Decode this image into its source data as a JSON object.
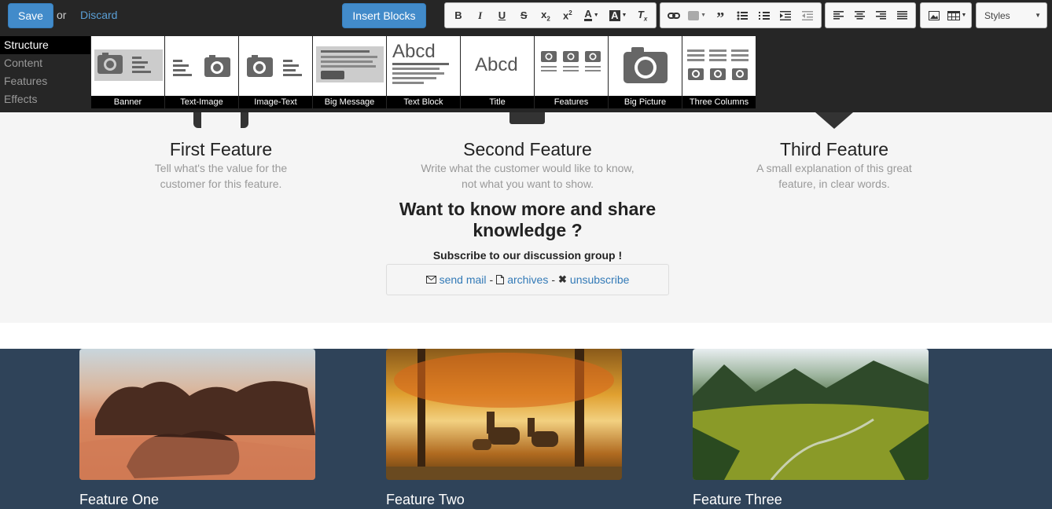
{
  "toolbar": {
    "save": "Save",
    "or": "or",
    "discard": "Discard",
    "insert_blocks": "Insert Blocks",
    "styles": "Styles",
    "format_icons": [
      "bold-icon",
      "italic-icon",
      "underline-icon",
      "strikethrough-icon",
      "subscript-icon",
      "superscript-icon",
      "text-color-icon",
      "background-color-icon",
      "remove-format-icon"
    ],
    "insert_icons": [
      "link-icon",
      "unlink-icon",
      "blockquote-icon",
      "bulleted-list-icon",
      "numbered-list-icon",
      "indent-icon",
      "outdent-icon"
    ],
    "align_icons": [
      "align-left-icon",
      "align-center-icon",
      "align-right-icon",
      "align-justify-icon"
    ],
    "media_icons": [
      "image-icon",
      "table-icon"
    ]
  },
  "snippet_panel": {
    "categories": [
      "Structure",
      "Content",
      "Features",
      "Effects"
    ],
    "active_category": "Structure",
    "blocks": [
      "Banner",
      "Text-Image",
      "Image-Text",
      "Big Message",
      "Text Block",
      "Title",
      "Features",
      "Big Picture",
      "Three Columns"
    ]
  },
  "features": [
    {
      "title": "First Feature",
      "desc": "Tell what's the value for the customer for this feature."
    },
    {
      "title": "Second Feature",
      "desc": "Write what the customer would like to know, not what you want to show."
    },
    {
      "title": "Third Feature",
      "desc": "A small explanation of this great feature, in clear words."
    }
  ],
  "cta": {
    "heading": "Want to know more and share knowledge ?",
    "subheading": "Subscribe to our discussion group !",
    "send_mail": "send mail",
    "archives": "archives",
    "unsubscribe": "unsubscribe",
    "sep": "-"
  },
  "cards": [
    {
      "title": "Feature One"
    },
    {
      "title": "Feature Two"
    },
    {
      "title": "Feature Three"
    }
  ],
  "colors": {
    "accent": "#428bca",
    "toolbar_bg": "#262626",
    "dark_section": "#2f4359"
  }
}
